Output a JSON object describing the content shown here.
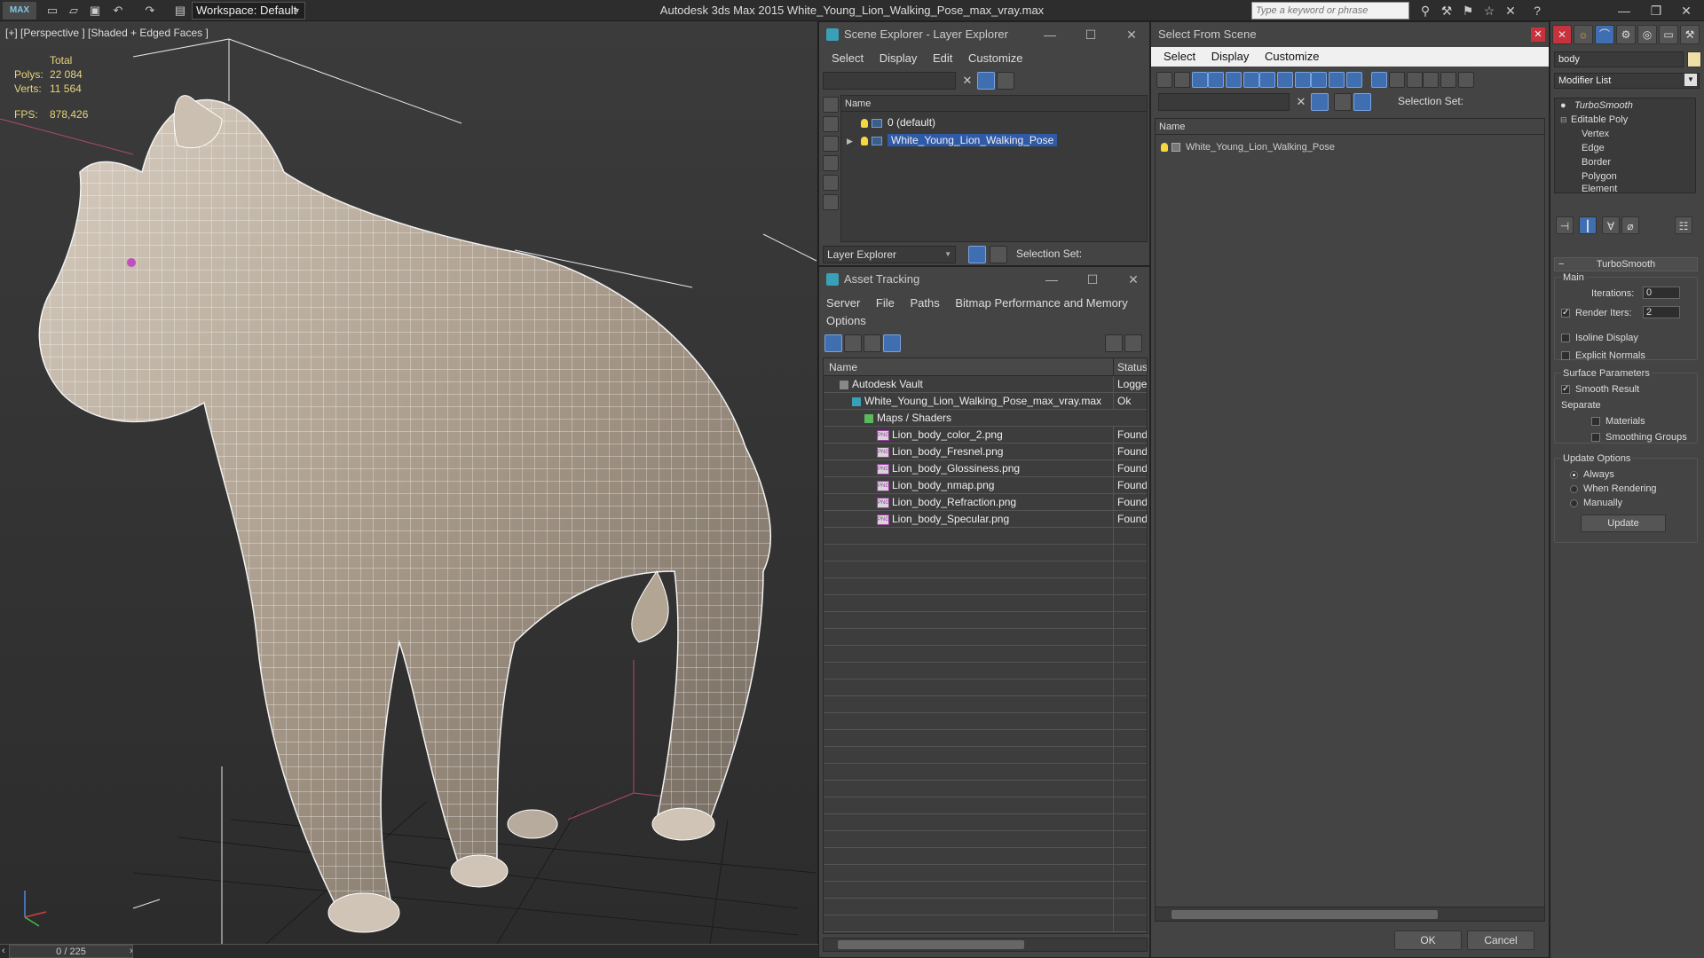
{
  "app": {
    "logo_text": "MAX",
    "workspace": "Workspace: Default",
    "title": "Autodesk 3ds Max  2015    White_Young_Lion_Walking_Pose_max_vray.max",
    "search_placeholder": "Type a keyword or phrase"
  },
  "viewport": {
    "label": "[+] [Perspective ] [Shaded + Edged Faces ]",
    "stats_header": "Total",
    "polys_label": "Polys:",
    "polys_value": "22 084",
    "verts_label": "Verts:",
    "verts_value": "11 564",
    "fps_label": "FPS:",
    "fps_value": "878,426",
    "frame_counter": "0 / 225"
  },
  "scene_explorer": {
    "title": "Scene Explorer - Layer Explorer",
    "menu": [
      "Select",
      "Display",
      "Edit",
      "Customize"
    ],
    "col_name": "Name",
    "rows": [
      "0 (default)",
      "White_Young_Lion_Walking_Pose"
    ],
    "explorer_dropdown": "Layer Explorer",
    "selection_set_label": "Selection Set:"
  },
  "asset_tracking": {
    "title": "Asset Tracking",
    "menu": [
      "Server",
      "File",
      "Paths",
      "Bitmap Performance and Memory",
      "Options"
    ],
    "col_name": "Name",
    "col_status": "Status",
    "rows": [
      {
        "name": "Autodesk Vault",
        "status": "Logged",
        "indent": 0
      },
      {
        "name": "White_Young_Lion_Walking_Pose_max_vray.max",
        "status": "Ok",
        "indent": 1
      },
      {
        "name": "Maps / Shaders",
        "status": "",
        "indent": 2
      },
      {
        "name": "Lion_body_color_2.png",
        "status": "Found",
        "indent": 3
      },
      {
        "name": "Lion_body_Fresnel.png",
        "status": "Found",
        "indent": 3
      },
      {
        "name": "Lion_body_Glossiness.png",
        "status": "Found",
        "indent": 3
      },
      {
        "name": "Lion_body_nmap.png",
        "status": "Found",
        "indent": 3
      },
      {
        "name": "Lion_body_Refraction.png",
        "status": "Found",
        "indent": 3
      },
      {
        "name": "Lion_body_Specular.png",
        "status": "Found",
        "indent": 3
      }
    ],
    "png_badge": "PNG"
  },
  "select_from_scene": {
    "title": "Select From Scene",
    "menu": [
      "Select",
      "Display",
      "Customize"
    ],
    "selection_set_label": "Selection Set:",
    "col_name": "Name",
    "rows": [
      "White_Young_Lion_Walking_Pose"
    ],
    "ok": "OK",
    "cancel": "Cancel"
  },
  "modifier_panel": {
    "object_name": "body",
    "modifier_list": "Modifier List",
    "stack": [
      "TurboSmooth",
      "Editable Poly",
      "Vertex",
      "Edge",
      "Border",
      "Polygon",
      "Element"
    ],
    "rollout_title": "TurboSmooth",
    "main_label": "Main",
    "iterations_label": "Iterations:",
    "iterations_value": "0",
    "render_iters_label": "Render Iters:",
    "render_iters_value": "2",
    "isoline": "Isoline Display",
    "explicit_normals": "Explicit Normals",
    "surface_params": "Surface Parameters",
    "smooth_result": "Smooth Result",
    "separate": "Separate",
    "materials": "Materials",
    "smoothing_groups": "Smoothing Groups",
    "update_options": "Update Options",
    "always": "Always",
    "when_rendering": "When Rendering",
    "manually": "Manually",
    "update_button": "Update"
  },
  "colors": {
    "selection": "#2f5aa8",
    "stats": "#e8d47a",
    "accent": "#3aa0b8"
  }
}
